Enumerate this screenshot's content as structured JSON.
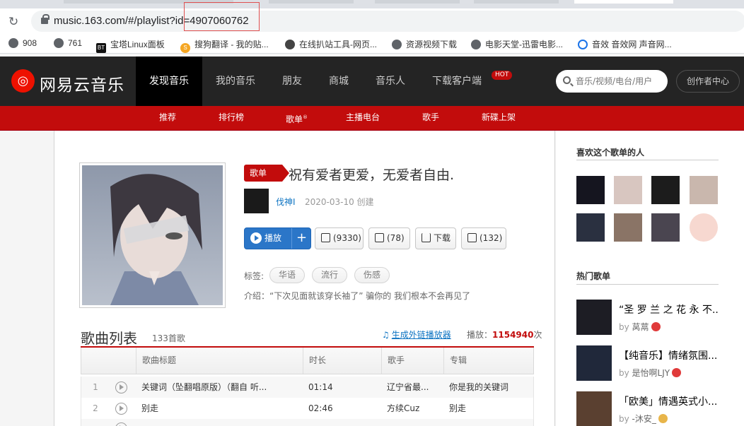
{
  "browser": {
    "url": "music.163.com/#/playlist?id=4907060762",
    "bookmarks": [
      {
        "label": "908"
      },
      {
        "label": "761"
      },
      {
        "label": "宝塔Linux面板"
      },
      {
        "label": "搜狗翻译 - 我的贴..."
      },
      {
        "label": "在线扒站工具-网页..."
      },
      {
        "label": "资源视频下载"
      },
      {
        "label": "电影天堂-迅雷电影..."
      },
      {
        "label": "音效 音效网 声音网..."
      }
    ]
  },
  "header": {
    "logo_text": "网易云音乐",
    "nav": [
      {
        "label": "发现音乐"
      },
      {
        "label": "我的音乐"
      },
      {
        "label": "朋友"
      },
      {
        "label": "商城"
      },
      {
        "label": "音乐人"
      },
      {
        "label": "下载客户端"
      }
    ],
    "hot_badge": "HOT",
    "search_placeholder": "音乐/视频/电台/用户",
    "creator_center": "创作者中心"
  },
  "subnav": [
    "推荐",
    "排行榜",
    "歌单",
    "主播电台",
    "歌手",
    "新碟上架"
  ],
  "playlist": {
    "tag": "歌单",
    "title": "祝有爱者更爱，无爱者自由.",
    "creator": "伐神I",
    "created": "2020-03-10 创建",
    "play_label": "播放",
    "plus_label": "+",
    "collect_label": "(9330)",
    "share_label": "(78)",
    "download_label": "下载",
    "comment_label": "(132)",
    "tags_label": "标签:",
    "tags": [
      "华语",
      "流行",
      "伤感"
    ],
    "intro": "介绍：“下次见面就该穿长袖了” 骗你的 我们根本不会再见了"
  },
  "song_list": {
    "title": "歌曲列表",
    "count": "133首歌",
    "outchain": "生成外链播放器",
    "play_count_label": "播放：",
    "play_count": "1154940",
    "play_count_unit": "次",
    "columns": [
      "歌曲标题",
      "时长",
      "歌手",
      "专辑"
    ],
    "rows": [
      {
        "idx": "1",
        "title": "关键词（坠翻唱原版）（翻自 听...",
        "duration": "01:14",
        "artist": "辽宁省最...",
        "album": "你是我的关键词"
      },
      {
        "idx": "2",
        "title": "别走",
        "duration": "02:46",
        "artist": "方续Cuz",
        "album": "别走"
      }
    ]
  },
  "sidebar": {
    "fans_title": "喜欢这个歌单的人",
    "hot_title": "热门歌单",
    "hot_lists": [
      {
        "title": "“圣 罗 兰 之 花 永 不...",
        "by": "by",
        "user": "莴蒚"
      },
      {
        "title": "【纯音乐】情绪氛围...",
        "by": "by",
        "user": "是怡啊LJY"
      },
      {
        "title": "「欧美」情遇英式小...",
        "by": "by",
        "user": "-沐安_"
      }
    ]
  },
  "colors": {
    "brand_red": "#c20c0c",
    "topbar": "#242424",
    "link_blue": "#0c73c2"
  }
}
